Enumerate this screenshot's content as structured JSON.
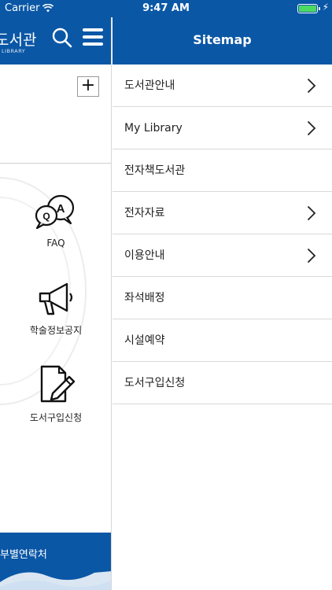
{
  "status_bar": {
    "carrier": "Carrier",
    "time": "9:47 AM",
    "battery_level": 1.0
  },
  "left_panel": {
    "logo_text": "도서관",
    "logo_subtext": "LIBRARY",
    "plus_label": "+",
    "quick_items": [
      {
        "label": "FAQ",
        "icon": "faq-icon"
      },
      {
        "label": "학술정보공지",
        "icon": "megaphone-icon"
      },
      {
        "label": "도서구입신청",
        "icon": "document-pencil-icon"
      }
    ],
    "footer_text": "부별연락처"
  },
  "sitemap": {
    "title": "Sitemap",
    "items": [
      {
        "label": "도서관안내",
        "has_submenu": true
      },
      {
        "label": "My Library",
        "has_submenu": true
      },
      {
        "label": "전자책도서관",
        "has_submenu": false
      },
      {
        "label": "전자자료",
        "has_submenu": true
      },
      {
        "label": "이용안내",
        "has_submenu": true
      },
      {
        "label": "좌석배정",
        "has_submenu": false
      },
      {
        "label": "시설예약",
        "has_submenu": false
      },
      {
        "label": "도서구입신청",
        "has_submenu": false
      }
    ]
  },
  "colors": {
    "brand_blue": "#0a57a6",
    "battery_green": "#4cd964",
    "divider": "#d9d9d9"
  }
}
